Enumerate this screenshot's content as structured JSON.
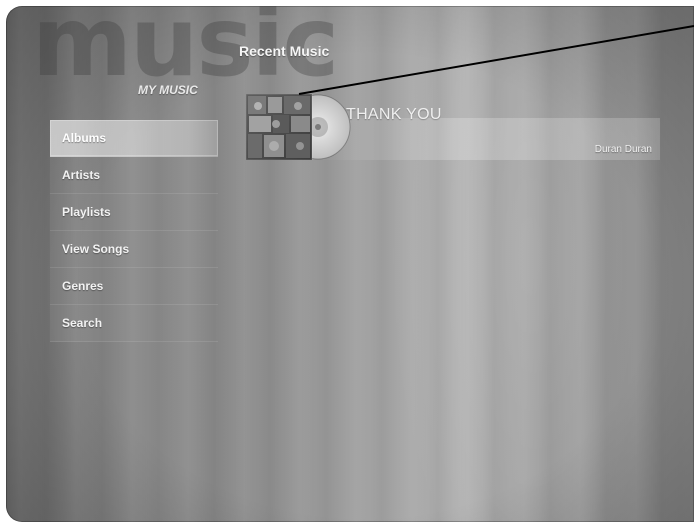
{
  "watermark": "music",
  "section": {
    "label": "MY MUSIC"
  },
  "sidebar": {
    "items": [
      {
        "label": "Albums",
        "selected": true
      },
      {
        "label": "Artists",
        "selected": false
      },
      {
        "label": "Playlists",
        "selected": false
      },
      {
        "label": "View Songs",
        "selected": false
      },
      {
        "label": "Genres",
        "selected": false
      },
      {
        "label": "Search",
        "selected": false
      }
    ]
  },
  "recent": {
    "title": "Recent Music",
    "album": {
      "title": "THANK YOU",
      "artist": "Duran Duran"
    }
  },
  "colors": {
    "background": "#8c8c8c",
    "text": "#f2f2f2",
    "callout_line": "#000000"
  },
  "icons": {
    "album_art": "album-cover-with-cd"
  }
}
